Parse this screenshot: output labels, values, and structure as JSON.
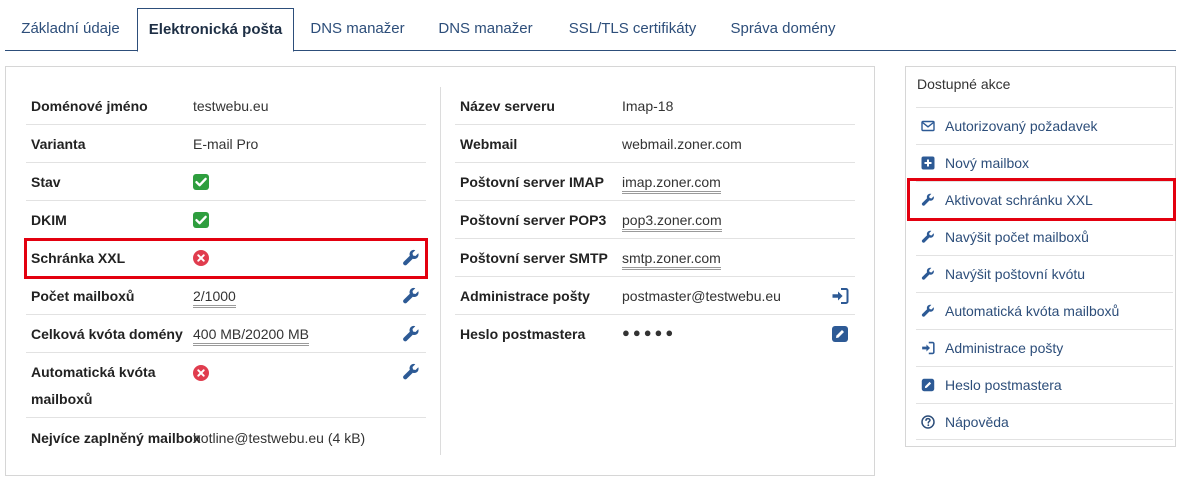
{
  "tabs": [
    {
      "label": "Základní údaje"
    },
    {
      "label": "Elektronická pošta"
    },
    {
      "label": "DNS manažer"
    },
    {
      "label": "DNS manažer"
    },
    {
      "label": "SSL/TLS certifikáty"
    },
    {
      "label": "Správa domény"
    }
  ],
  "left": {
    "domain_name": {
      "label": "Doménové jméno",
      "value": "testwebu.eu"
    },
    "variant": {
      "label": "Varianta",
      "value": "E-mail Pro"
    },
    "status": {
      "label": "Stav"
    },
    "dkim": {
      "label": "DKIM"
    },
    "xxl": {
      "label": "Schránka XXL"
    },
    "mailbox_count": {
      "label": "Počet mailboxů",
      "value": "2/1000"
    },
    "domain_quota": {
      "label": "Celková kvóta domény",
      "value": "400 MB/20200 MB"
    },
    "auto_quota": {
      "label_line1": "Automatická kvóta",
      "label_line2": "mailboxů"
    },
    "fullest": {
      "label": "Nejvíce zaplněný mailbox",
      "value": "hotline@testwebu.eu (4 kB)"
    }
  },
  "right": {
    "server_name": {
      "label": "Název serveru",
      "value": "Imap-18"
    },
    "webmail": {
      "label": "Webmail",
      "value": "webmail.zoner.com"
    },
    "imap": {
      "label": "Poštovní server IMAP",
      "value": "imap.zoner.com"
    },
    "pop3": {
      "label": "Poštovní server POP3",
      "value": "pop3.zoner.com"
    },
    "smtp": {
      "label": "Poštovní server SMTP",
      "value": "smtp.zoner.com"
    },
    "admin": {
      "label": "Administrace pošty",
      "value": "postmaster@testwebu.eu"
    },
    "password": {
      "label": "Heslo postmastera",
      "value": "●●●●●"
    }
  },
  "actions": {
    "title": "Dostupné akce",
    "items": [
      {
        "label": "Autorizovaný požadavek",
        "icon": "envelope-icon"
      },
      {
        "label": "Nový mailbox",
        "icon": "plus-square-icon"
      },
      {
        "label": "Aktivovat schránku XXL",
        "icon": "wrench-icon"
      },
      {
        "label": "Navýšit počet mailboxů",
        "icon": "wrench-icon"
      },
      {
        "label": "Navýšit poštovní kvótu",
        "icon": "wrench-icon"
      },
      {
        "label": "Automatická kvóta mailboxů",
        "icon": "wrench-icon"
      },
      {
        "label": "Administrace pošty",
        "icon": "sign-in-icon"
      },
      {
        "label": "Heslo postmastera",
        "icon": "edit-square-icon"
      },
      {
        "label": "Nápověda",
        "icon": "help-circle-icon"
      }
    ]
  },
  "colors": {
    "accent": "#2d4e7a",
    "success": "#2e9e3e",
    "danger": "#e03c4e",
    "highlight": "#e3000f"
  }
}
